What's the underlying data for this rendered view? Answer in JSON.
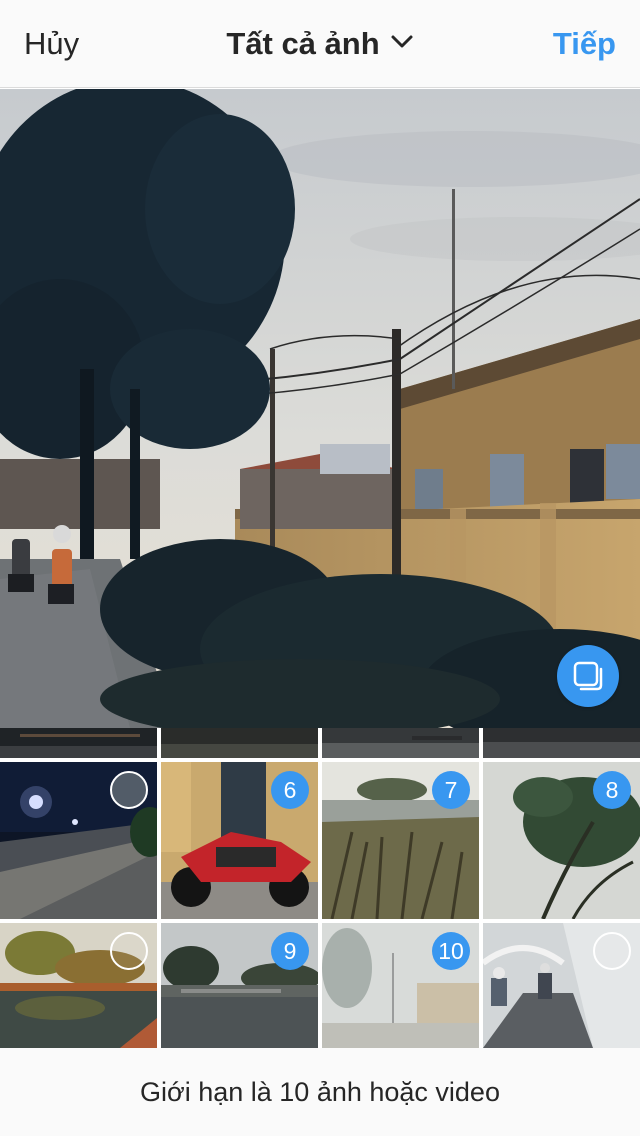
{
  "header": {
    "cancel_label": "Hủy",
    "title": "Tất cả ảnh",
    "next_label": "Tiếp"
  },
  "preview": {
    "multi_select_icon": "multi-select-icon"
  },
  "grid": {
    "selection_badges": [
      "6",
      "7",
      "8",
      "9",
      "10"
    ]
  },
  "footer": {
    "limit_text": "Giới hạn là 10 ảnh hoặc video"
  },
  "colors": {
    "accent": "#3897f0",
    "text": "#262626",
    "bar_background": "#fafafa"
  }
}
